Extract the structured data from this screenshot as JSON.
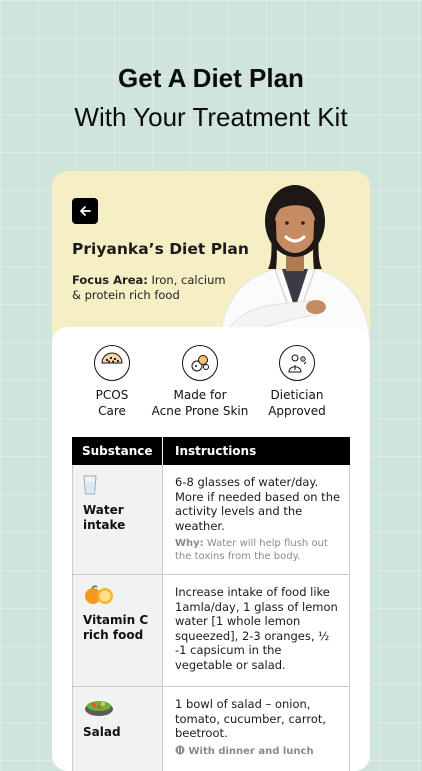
{
  "headline": {
    "line1": "Get A Diet Plan",
    "line2": "With Your Treatment Kit"
  },
  "plan": {
    "title": "Priyanka’s Diet Plan",
    "focus_label": "Focus Area:",
    "focus_text": " Iron, calcium & protein rich food"
  },
  "badges": [
    {
      "label": "PCOS\nCare",
      "icon": "pcos-icon"
    },
    {
      "label": "Made for\nAcne Prone Skin",
      "icon": "acne-skin-icon"
    },
    {
      "label": "Dietician\nApproved",
      "icon": "dietician-icon"
    }
  ],
  "table": {
    "headers": [
      "Substance",
      "Instructions"
    ],
    "rows": [
      {
        "substance": "Water intake",
        "icon": "water-glass-icon",
        "instruction": "6-8 glasses of water/day. More if needed based on the activity levels and the weather.",
        "why_label": "Why:",
        "why_text": " Water will help flush out the toxins from the body."
      },
      {
        "substance": "Vitamin C rich food",
        "icon": "oranges-icon",
        "instruction": "Increase intake of food like 1amla/day, 1 glass of lemon water [1 whole lemon squeezed], 2-3 oranges, ½ -1 capsicum in the vegetable or salad.",
        "why_label": "",
        "why_text": ""
      },
      {
        "substance": "Salad",
        "icon": "salad-bowl-icon",
        "instruction": "1 bowl of salad – onion, tomato, cucumber, carrot, beetroot.",
        "why_label": "",
        "why_text": "With dinner and lunch"
      }
    ]
  }
}
